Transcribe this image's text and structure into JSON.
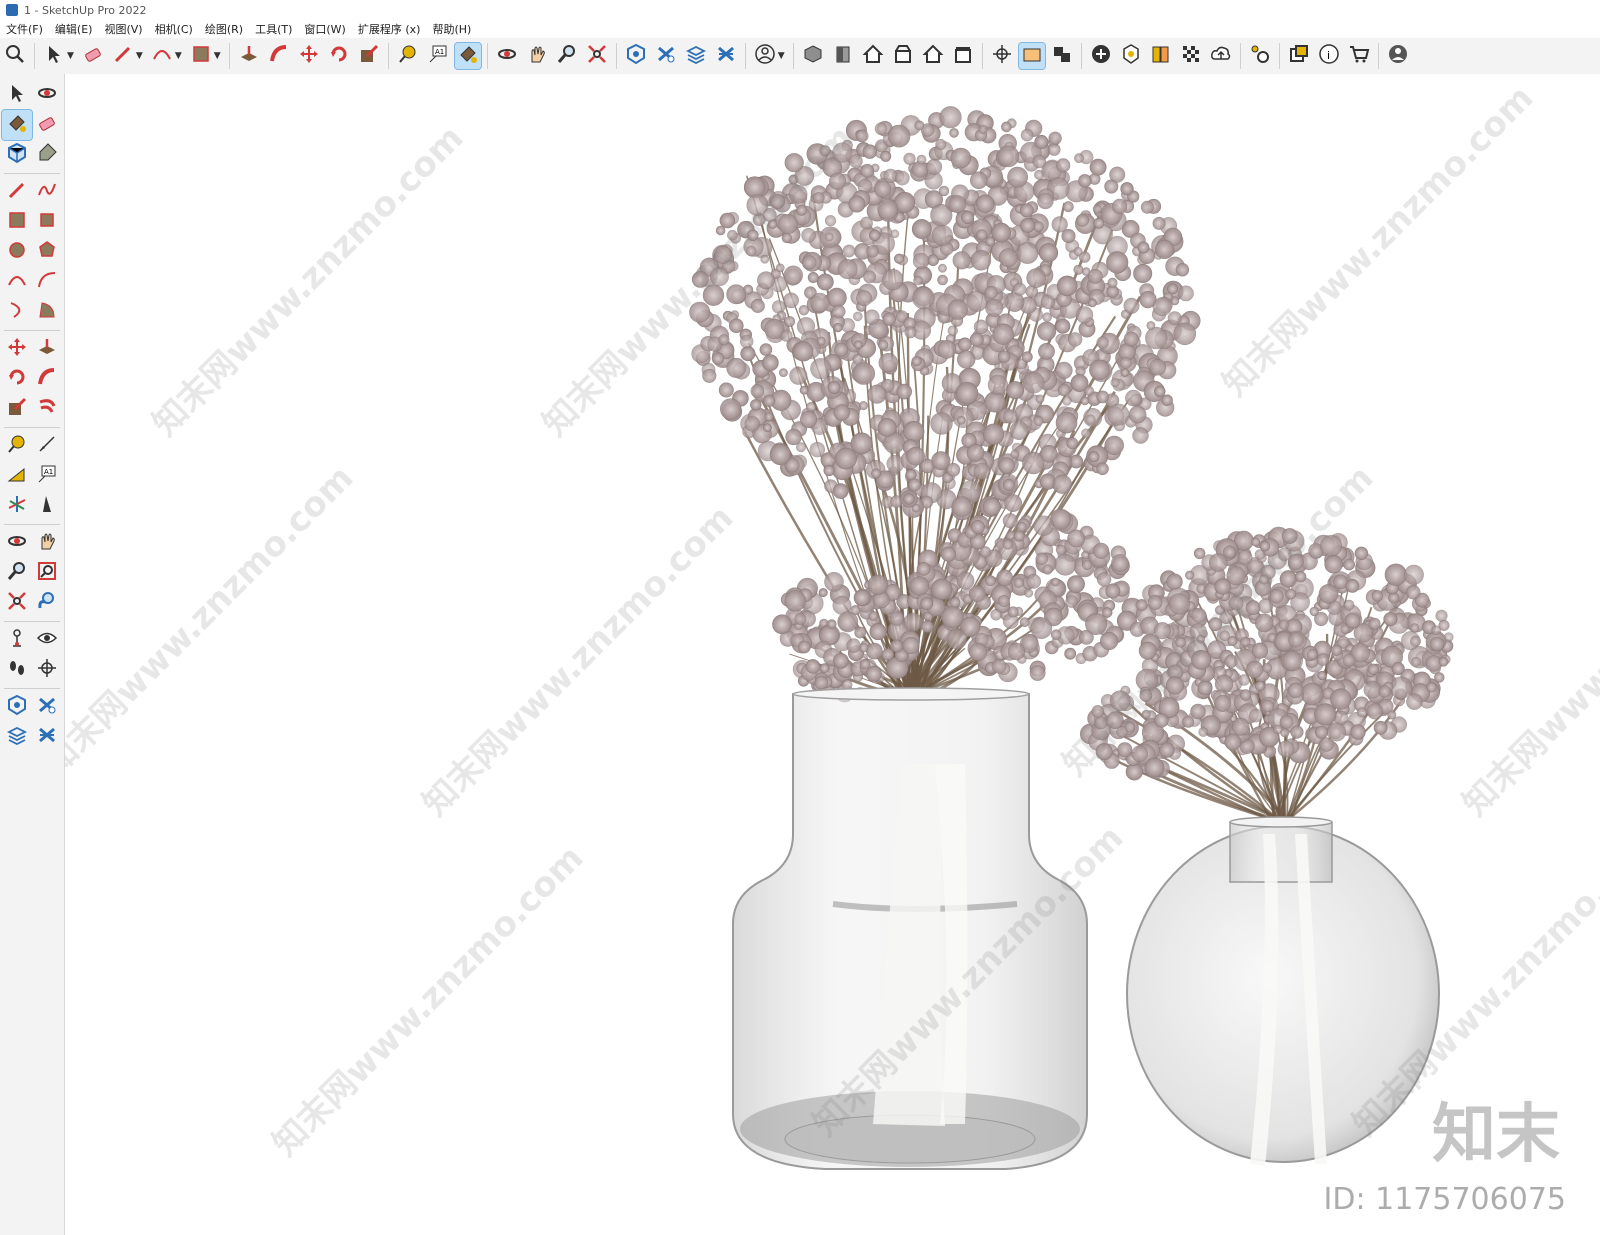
{
  "window": {
    "title": "1 - SketchUp Pro 2022"
  },
  "menu": [
    "文件(F)",
    "编辑(E)",
    "视图(V)",
    "相机(C)",
    "绘图(R)",
    "工具(T)",
    "窗口(W)",
    "扩展程序 (x)",
    "帮助(H)"
  ],
  "toolbar": {
    "groups": [
      [
        "search-icon"
      ],
      [
        "select-icon",
        "eraser-icon",
        "pencil-icon",
        "arc-icon",
        "rectangle-icon"
      ],
      [
        "push-pull-icon",
        "follow-me-icon",
        "move-icon",
        "rotate-icon",
        "scale-icon"
      ],
      [
        "tape-measure-icon",
        "text-icon",
        "paint-bucket-icon"
      ],
      [
        "orbit-icon",
        "pan-icon",
        "zoom-icon",
        "zoom-extents-icon"
      ],
      [
        "warehouse-icon",
        "extension-icon",
        "layers-icon",
        "sandbox-icon"
      ],
      [
        "profile-icon"
      ],
      [
        "iso-view-icon",
        "front-view-icon",
        "top-view-icon",
        "right-view-icon",
        "back-view-icon",
        "left-view-icon"
      ],
      [
        "section-plane-icon",
        "section-display-icon",
        "section-cut-icon"
      ],
      [
        "add-location-icon",
        "shadow-icon",
        "style-icon",
        "xray-icon",
        "upload-icon"
      ],
      [
        "settings-icon"
      ],
      [
        "layout-icon",
        "info-icon",
        "cart-icon"
      ],
      [
        "account-icon"
      ]
    ]
  },
  "sidebar": {
    "rows": [
      [
        "select-icon",
        "orbit-icon"
      ],
      [
        "paint-bucket-icon",
        "eraser-icon"
      ],
      [
        "component-icon",
        "tag-icon"
      ],
      "sep",
      [
        "line-icon",
        "freehand-icon"
      ],
      [
        "rectangle-icon",
        "rotated-rectangle-icon"
      ],
      [
        "circle-icon",
        "polygon-icon"
      ],
      [
        "arc-icon",
        "two-point-arc-icon"
      ],
      [
        "three-point-arc-icon",
        "pie-icon"
      ],
      "sep",
      [
        "move-icon",
        "push-pull-icon"
      ],
      [
        "rotate-icon",
        "follow-me-icon"
      ],
      [
        "scale-icon",
        "offset-icon"
      ],
      "sep",
      [
        "tape-measure-icon",
        "dimension-icon"
      ],
      [
        "protractor-icon",
        "text-icon"
      ],
      [
        "axes-icon",
        "3d-text-icon"
      ],
      "sep",
      [
        "orbit-icon",
        "pan-icon"
      ],
      [
        "zoom-icon",
        "zoom-window-icon"
      ],
      [
        "zoom-extents-icon",
        "previous-view-icon"
      ],
      "sep",
      [
        "position-camera-icon",
        "look-around-icon"
      ],
      [
        "walk-icon",
        "section-plane-icon"
      ],
      "sep",
      [
        "warehouse-icon",
        "extension-icon"
      ],
      [
        "layers-icon",
        "sandbox-icon"
      ]
    ]
  },
  "watermark_text": "知末网www.znzmo.com",
  "brand": {
    "logo_text": "知末",
    "id_text": "ID: 1175706075"
  },
  "colors": {
    "toolbar_bg": "#f3f3f3",
    "active_bg": "#bfe0f7",
    "flower": "#b9a9a9",
    "stem": "#6d5a45"
  }
}
